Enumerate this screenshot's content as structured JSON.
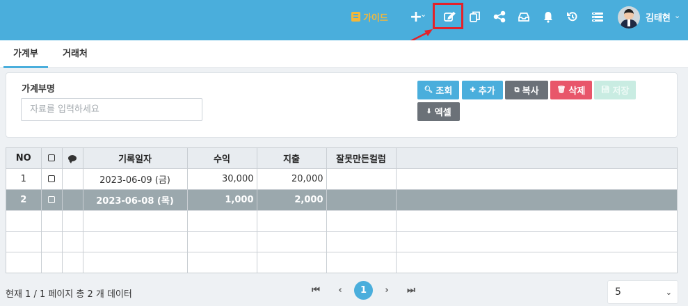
{
  "topbar": {
    "guide_label": "가이드",
    "username": "김태현",
    "icons": [
      "plus-icon",
      "edit-icon",
      "copy-icon",
      "share-icon",
      "inbox-icon",
      "bell-icon",
      "history-icon",
      "list-icon"
    ],
    "annotation": "①",
    "background": "#4aaedc"
  },
  "tabs": [
    {
      "label": "가계부",
      "active": true
    },
    {
      "label": "거래처",
      "active": false
    }
  ],
  "search": {
    "field_label": "가계부명",
    "placeholder": "자료를 입력하세요"
  },
  "buttons": {
    "search": "조회",
    "add": "추가",
    "copy": "복사",
    "delete": "삭제",
    "save": "저장",
    "excel": "엑셀"
  },
  "grid": {
    "headers": [
      "NO",
      "",
      "",
      "기록일자",
      "수익",
      "지출",
      "잘못만든컬럼",
      ""
    ],
    "rows": [
      {
        "no": "1",
        "date": "2023-06-09 (금)",
        "income": "30,000",
        "expense": "20,000",
        "bad": ""
      },
      {
        "no": "2",
        "date": "2023-06-08 (목)",
        "income": "1,000",
        "expense": "2,000",
        "bad": ""
      }
    ]
  },
  "footer": {
    "page_info": "현재 1 / 1 페이지 총 2 개 데이터",
    "current_page": "1",
    "page_size": "5"
  }
}
